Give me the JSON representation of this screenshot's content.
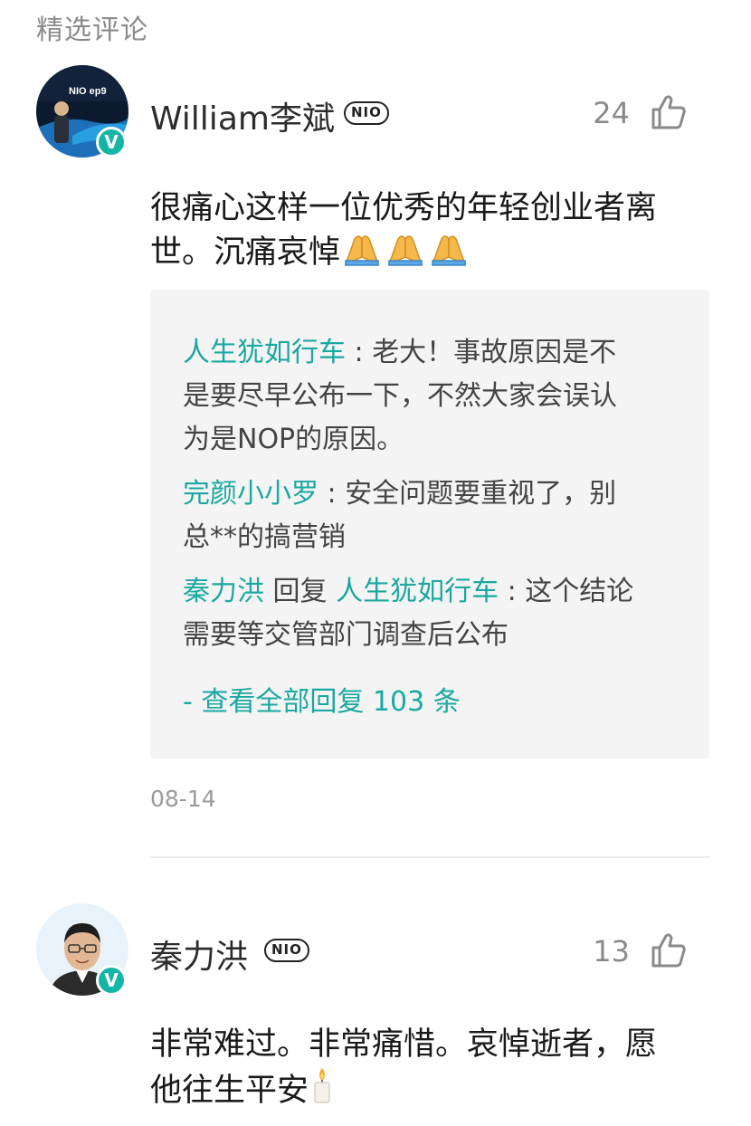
{
  "section_title": "精选评论",
  "comments": [
    {
      "username": "William李斌",
      "badge": "NIO",
      "verified_mark": "V",
      "likes": "24",
      "content_line1": "很痛心这样一位优秀的年轻创业者离",
      "content_line2": "世。沉痛哀悼",
      "content_emoji": "folded-hands-emoji ×3",
      "avatar_text": "NIO ep9",
      "replies": [
        {
          "name": "人生犹如行车",
          "separator": " : ",
          "text_line1": "老大！事故原因是不",
          "text_line2": "是要尽早公布一下，不然大家会误认",
          "text_line3": "为是NOP的原因。"
        },
        {
          "name": "完颜小小罗",
          "separator": " : ",
          "text_line1": "安全问题要重视了，别",
          "text_line2": "总**的搞营销"
        },
        {
          "name": "秦力洪",
          "reply_word": " 回复 ",
          "reply_to": "人生犹如行车",
          "separator": " : ",
          "text_line1": "这个结论",
          "text_line2": "需要等交管部门调查后公布"
        }
      ],
      "view_all": "- 查看全部回复 103 条",
      "date": "08-14"
    },
    {
      "username": "秦力洪",
      "badge": "NIO",
      "verified_mark": "V",
      "likes": "13",
      "content_line1": "非常难过。非常痛惜。哀悼逝者，愿",
      "content_line2": "他往生平安",
      "content_emoji": "candle-emoji"
    }
  ],
  "colors": {
    "accent_teal": "#1aa8a0",
    "verified_badge": "#12b5a6",
    "muted_text": "#8a8a8a",
    "reply_bg": "#f4f4f4"
  }
}
